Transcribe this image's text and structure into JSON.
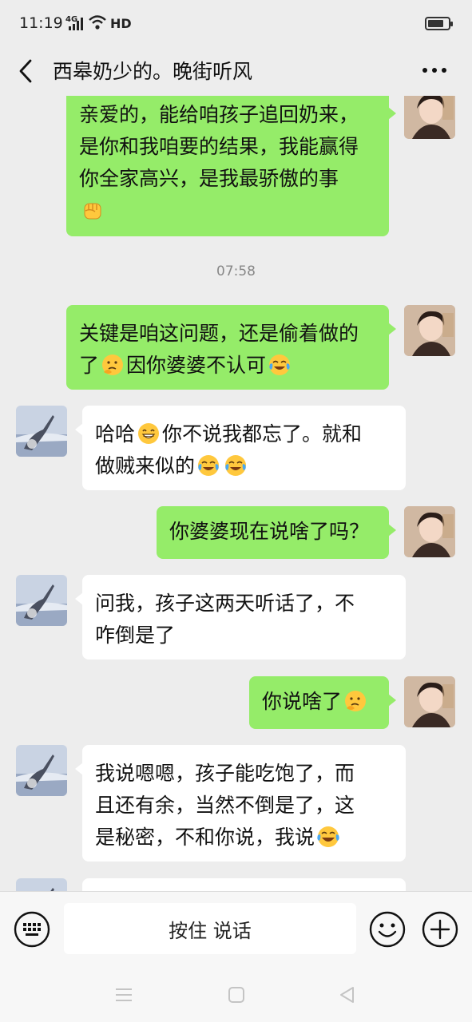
{
  "status_bar": {
    "time": "11:19",
    "network": "4G",
    "hd": "HD"
  },
  "header": {
    "title": "西皋奶少的。晚街听风"
  },
  "messages": [
    {
      "side": "right",
      "lines": [
        "亲爱的，能给咱孩子追回奶来，",
        "是你和我咱要的结果，我能赢得",
        "你全家高兴，是我最骄傲的事"
      ],
      "emoji": "fist"
    },
    {
      "timestamp": "07:58"
    },
    {
      "side": "right",
      "line1": "关键是咱这问题，还是偷着做的",
      "line2_a": "了",
      "line2_b": "因你婆婆不认可"
    },
    {
      "side": "left",
      "line1_a": "哈哈",
      "line1_b": "你不说我都忘了。就和",
      "line2": "做贼来似的"
    },
    {
      "side": "right",
      "text": "你婆婆现在说啥了吗？"
    },
    {
      "side": "left",
      "lines": [
        "问我，孩子这两天听话了，不",
        "咋倒是了"
      ]
    },
    {
      "side": "right",
      "text": "你说啥了"
    },
    {
      "side": "left",
      "lines": [
        "我说嗯嗯，孩子能吃饱了，而",
        "且还有余，当然不倒是了，这"
      ],
      "line3": "是秘密，不和你说，我说"
    }
  ],
  "input_bar": {
    "push_to_talk": "按住 说话"
  },
  "colors": {
    "right_bubble": "#95ec69",
    "left_bubble": "#ffffff",
    "background": "#ededed"
  },
  "icons": [
    "back-arrow-icon",
    "more-icon",
    "keyboard-icon",
    "emoji-icon",
    "plus-icon",
    "menu-icon",
    "home-icon",
    "back-triangle-icon"
  ]
}
